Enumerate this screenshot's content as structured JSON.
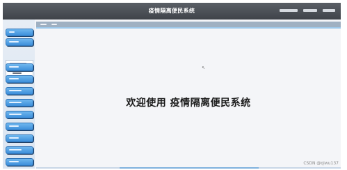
{
  "header": {
    "title": "疫情隔离便民系统"
  },
  "main": {
    "welcome_text": "欢迎使用 疫情隔离便民系统"
  },
  "watermark": "CSDN @qiwu137",
  "colors": {
    "header_bg": "#4a4e54",
    "menu_accent": "#4a9be3",
    "breadcrumb_bg": "#9fb0c2"
  }
}
